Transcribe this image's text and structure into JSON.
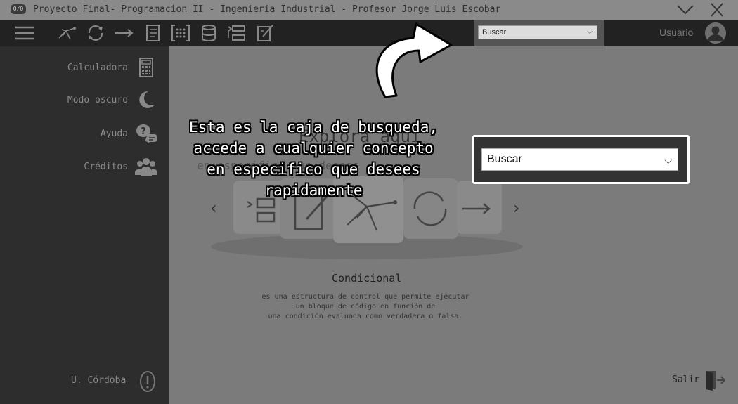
{
  "window": {
    "app_icon_text": "O/O",
    "title": "Proyecto Final- Programacion II - Ingenieria Industrial - Profesor Jorge Luis Escobar"
  },
  "toolbar": {
    "icons": [
      "menu-icon",
      "sparkles-icon",
      "cycle-icon",
      "arrow-right-icon",
      "document-icon",
      "matrix-icon",
      "database-icon",
      "list-flow-icon",
      "edit-icon"
    ],
    "search": {
      "value": "Buscar"
    },
    "user_label": "Usuario"
  },
  "sidebar": {
    "items": [
      {
        "label": "Calculadora",
        "icon": "calculator-icon"
      },
      {
        "label": "Modo oscuro",
        "icon": "moon-icon"
      },
      {
        "label": "Ayuda",
        "icon": "help-chat-icon"
      },
      {
        "label": "Créditos",
        "icon": "people-icon"
      }
    ],
    "footer_label": "U. Córdoba"
  },
  "main": {
    "title": "Explora aqui",
    "subtitle": "en especifico que desees",
    "concept_title": "Condicional",
    "concept_desc": [
      "es una estructura de control que permite ejecutar",
      "un bloque de código en función de",
      "una condición evaluada como verdadera o falsa."
    ],
    "exit_label": "Salir"
  },
  "tutorial": {
    "lines": [
      "Esta es la caja de busqueda,",
      "accede a cualquier concepto",
      "en especifico que desees",
      "rapidamente"
    ],
    "search_value": "Buscar"
  },
  "colors": {
    "toolbar_bg": "#222222",
    "sidebar_bg": "#2d2d2d",
    "main_bg": "#7b7b7b",
    "titlebar_bg": "#8a8a8a",
    "overlay_text": "#ffffff"
  }
}
